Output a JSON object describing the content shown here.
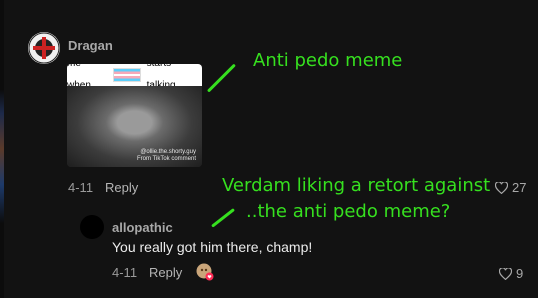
{
  "comment": {
    "author": "Dragan",
    "media_caption": "me when",
    "media_caption_suffix": "starts talking",
    "watermark": "@ollie.the.shorty.guy\nFrom TikTok comment",
    "date": "4-11",
    "reply_label": "Reply",
    "like_count": "27"
  },
  "reply": {
    "author": "allopathic",
    "text": "You really got him there, champ!",
    "date": "4-11",
    "reply_label": "Reply",
    "like_count": "9"
  },
  "annotations": {
    "first": "Anti pedo meme",
    "second_line1": "Verdam liking a retort against",
    "second_line2": "..the anti pedo meme?"
  },
  "colors": {
    "annotation": "#36e01f",
    "background": "#121212"
  },
  "icons": {
    "heart": "heart-icon",
    "liked_by_creator": "creator-like-avatar"
  }
}
